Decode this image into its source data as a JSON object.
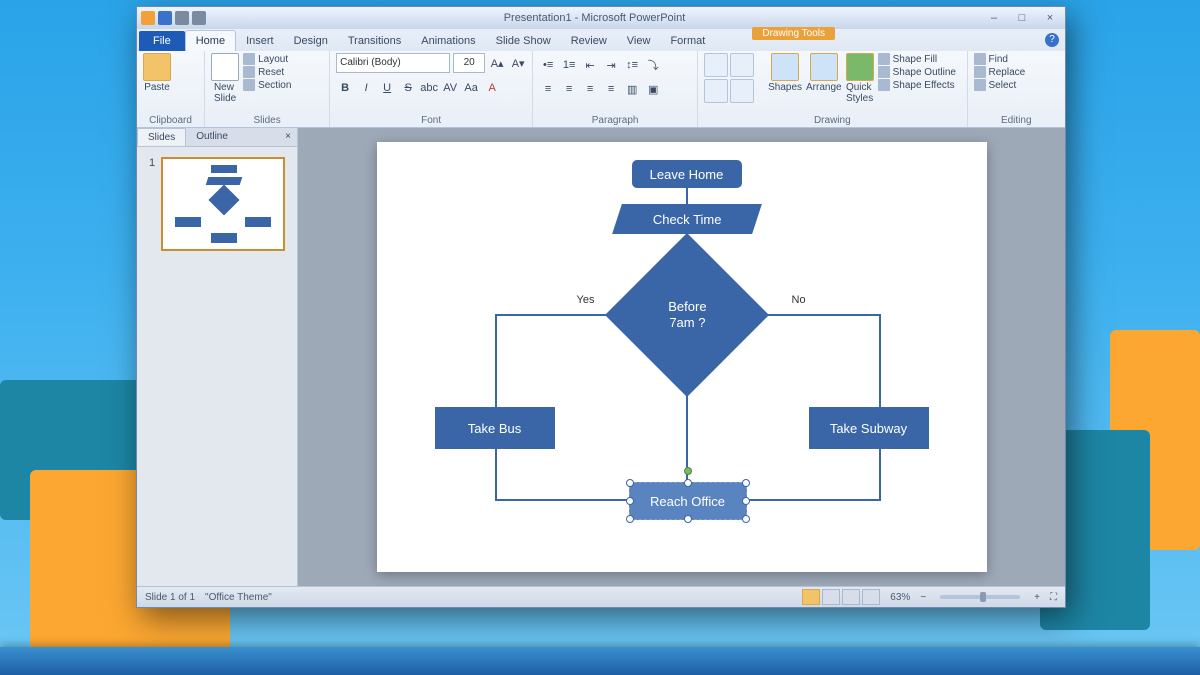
{
  "window": {
    "doc_name": "Presentation1",
    "app_name": "Microsoft PowerPoint",
    "title_sep": "  -  ",
    "context_tab": "Drawing Tools",
    "min": "–",
    "max": "□",
    "close": "×"
  },
  "tabs": {
    "file": "File",
    "items": [
      "Home",
      "Insert",
      "Design",
      "Transitions",
      "Animations",
      "Slide Show",
      "Review",
      "View",
      "Format"
    ],
    "active": "Home"
  },
  "ribbon": {
    "clipboard": {
      "label": "Clipboard",
      "paste": "Paste"
    },
    "slides": {
      "label": "Slides",
      "new_slide": "New\nSlide",
      "layout": "Layout",
      "reset": "Reset",
      "section": "Section"
    },
    "font": {
      "label": "Font",
      "family": "Calibri (Body)",
      "size": "20",
      "bold": "B",
      "italic": "I",
      "underline": "U",
      "strike": "S",
      "shadow": "abc",
      "charsp": "AV",
      "case": "Aa",
      "clear": "A"
    },
    "paragraph": {
      "label": "Paragraph"
    },
    "drawing": {
      "label": "Drawing",
      "shapes": "Shapes",
      "arrange": "Arrange",
      "quick": "Quick\nStyles",
      "fill": "Shape Fill",
      "outline": "Shape Outline",
      "effects": "Shape Effects"
    },
    "editing": {
      "label": "Editing",
      "find": "Find",
      "replace": "Replace",
      "select": "Select"
    }
  },
  "leftpanel": {
    "slides_tab": "Slides",
    "outline_tab": "Outline",
    "close": "×",
    "slide_num": "1"
  },
  "flowchart": {
    "start": "Leave Home",
    "check": "Check Time",
    "decision": "Before\n7am ?",
    "yes": "Yes",
    "no": "No",
    "bus": "Take Bus",
    "subway": "Take Subway",
    "end": "Reach Office"
  },
  "status": {
    "slide": "Slide 1 of 1",
    "theme": "\"Office Theme\"",
    "zoom": "63%",
    "minus": "−",
    "plus": "+"
  }
}
